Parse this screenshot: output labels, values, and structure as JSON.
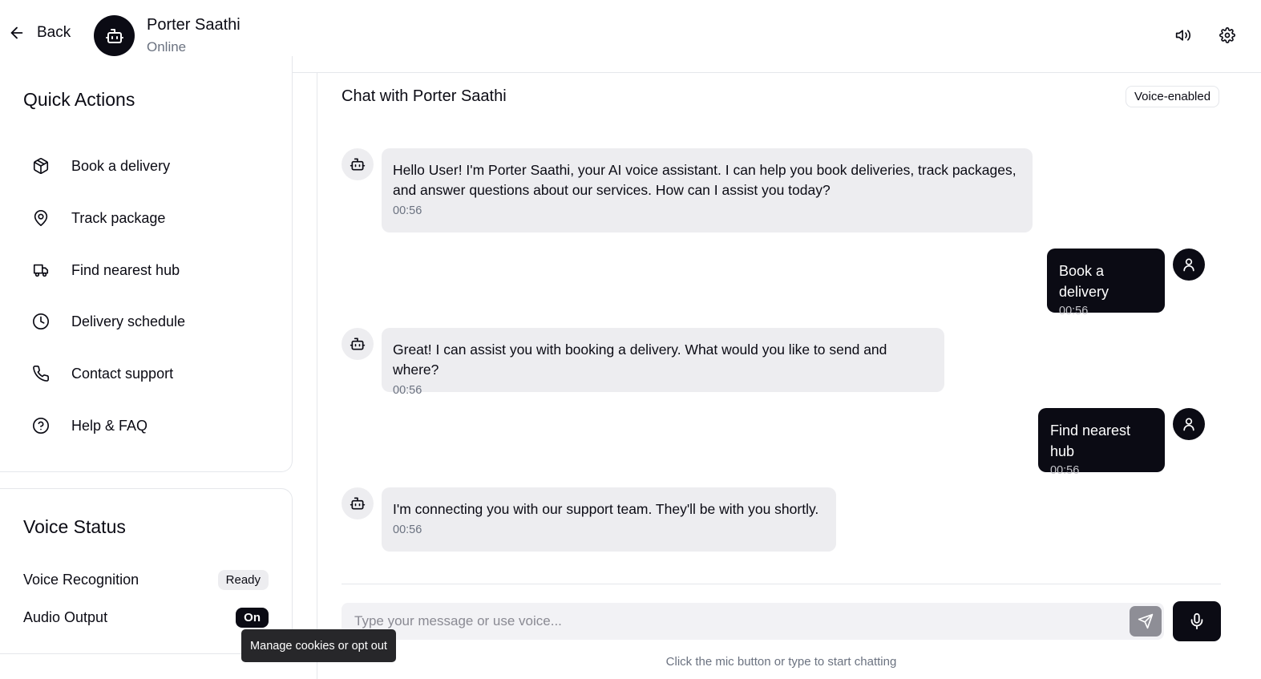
{
  "header": {
    "back_label": "Back",
    "bot_name": "Porter Saathi",
    "bot_status": "Online"
  },
  "quick_actions": {
    "title": "Quick Actions",
    "items": [
      {
        "label": "Book a delivery",
        "icon": "package-icon"
      },
      {
        "label": "Track package",
        "icon": "map-pin-icon"
      },
      {
        "label": "Find nearest hub",
        "icon": "truck-icon"
      },
      {
        "label": "Delivery schedule",
        "icon": "clock-icon"
      },
      {
        "label": "Contact support",
        "icon": "phone-icon"
      },
      {
        "label": "Help & FAQ",
        "icon": "help-circle-icon"
      }
    ]
  },
  "voice_status": {
    "title": "Voice Status",
    "recognition_label": "Voice Recognition",
    "recognition_value": "Ready",
    "output_label": "Audio Output",
    "output_value": "On"
  },
  "cookie_tooltip": "Manage cookies or opt out",
  "chat": {
    "title": "Chat with Porter Saathi",
    "badge": "Voice-enabled",
    "messages": [
      {
        "from": "bot",
        "text": "Hello User! I'm Porter Saathi, your AI voice assistant. I can help you book deliveries, track packages, and answer questions about our services. How can I assist you today?",
        "time": "00:56"
      },
      {
        "from": "user",
        "text": "Book a delivery",
        "time": "00:56"
      },
      {
        "from": "bot",
        "text": "Great! I can assist you with booking a delivery. What would you like to send and where?",
        "time": "00:56"
      },
      {
        "from": "user",
        "text": "Find nearest hub",
        "time": "00:56"
      },
      {
        "from": "bot",
        "text": "I'm connecting you with our support team. They'll be with you shortly.",
        "time": "00:56"
      }
    ],
    "input_placeholder": "Type your message or use voice...",
    "hint": "Click the mic button or type to start chatting"
  },
  "colors": {
    "primary": "#0b0b14",
    "bubble_bot": "#ededf0",
    "muted_text": "#6b7280"
  }
}
